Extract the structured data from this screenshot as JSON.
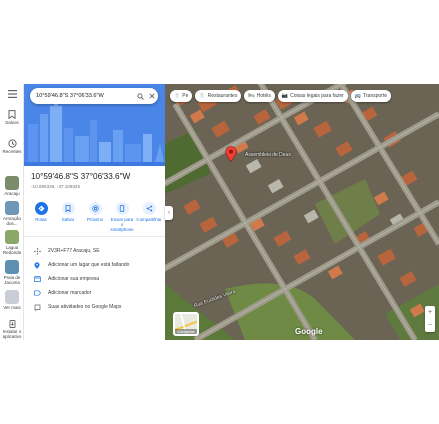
{
  "rail": {
    "menu_icon": "menu-icon",
    "items": [
      {
        "label": "Salvos",
        "icon": "bookmark-icon"
      },
      {
        "label": "Recentes",
        "icon": "history-icon"
      }
    ],
    "recent_places": [
      {
        "label": "Aracaju",
        "color": "#7a8c6a"
      },
      {
        "label": "Armação dos...",
        "color": "#6f98b8"
      },
      {
        "label": "Lagoa Redonda",
        "color": "#8aa868"
      },
      {
        "label": "Praia de Jacuma",
        "color": "#5c8fb0"
      },
      {
        "label": "Ver mais",
        "color": "#c9ced6"
      }
    ],
    "install_label": "Instalar o aplicativo"
  },
  "search": {
    "query": "10°59'46.8\"S 37°06'33.6\"W"
  },
  "place": {
    "title": "10°59'46.8\"S 37°06'33.6\"W",
    "subtitle": "-10.996335, -37.109325"
  },
  "actions": [
    {
      "label": "Rotas",
      "icon": "directions-icon",
      "primary": true
    },
    {
      "label": "Salvar",
      "icon": "bookmark-icon",
      "primary": false
    },
    {
      "label": "Próximo",
      "icon": "nearby-icon",
      "primary": false
    },
    {
      "label": "Enviar para o smartphone",
      "icon": "phone-icon",
      "primary": false
    },
    {
      "label": "Compartilhar",
      "icon": "share-icon",
      "primary": false
    }
  ],
  "info_rows": [
    {
      "icon": "plus-code-icon",
      "text": "2V3R+F77 Aracaju, SE"
    },
    {
      "icon": "add-place-icon",
      "text": "Adicionar um lugar que está faltando"
    },
    {
      "icon": "business-icon",
      "text": "Adicionar sua empresa"
    },
    {
      "icon": "label-icon",
      "text": "Adicionar marcador"
    },
    {
      "icon": "activity-icon",
      "text": "Suas atividades no Google Maps"
    }
  ],
  "map": {
    "chips": [
      {
        "label": "Pe",
        "icon": "fork-knife-icon"
      },
      {
        "label": "Restaurantes",
        "icon": "fork-knife-icon"
      },
      {
        "label": "Hotéis",
        "icon": "hotel-icon"
      },
      {
        "label": "Coisas legais para fazer",
        "icon": "camera-icon"
      },
      {
        "label": "Transporte",
        "icon": "transit-icon"
      }
    ],
    "street_label": "Rua Euclides Vieira",
    "place_label": "Assembleia de Deus",
    "layers_label": "Camadas",
    "logo": "Google"
  },
  "colors": {
    "accent": "#1a73e8",
    "hero": "#4285f4",
    "pin": "#ea4335"
  }
}
